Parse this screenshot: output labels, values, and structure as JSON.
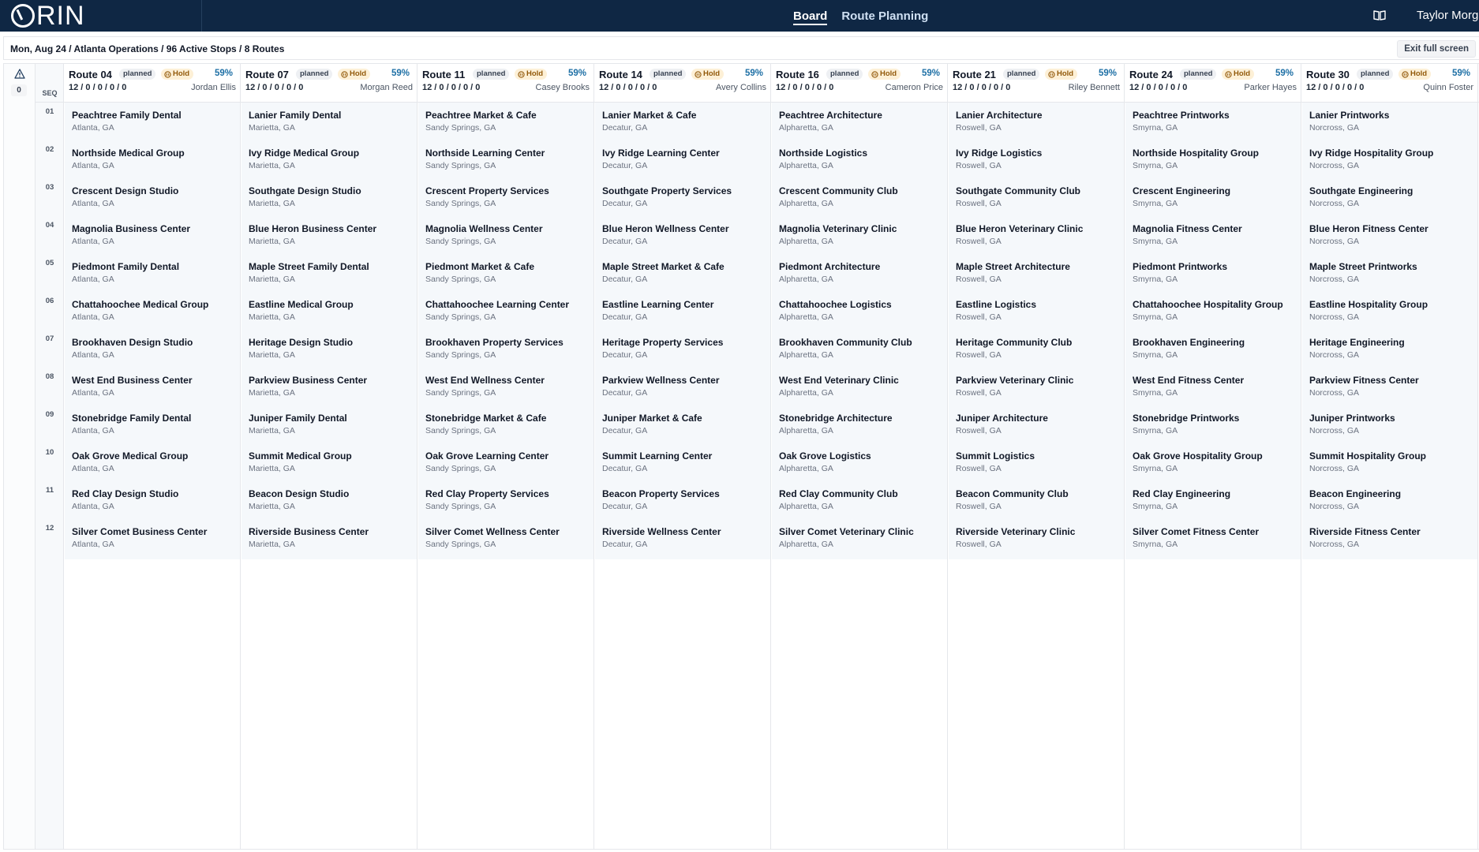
{
  "app": {
    "logo_text": "ORIN",
    "nav": [
      {
        "label": "Board",
        "active": true
      },
      {
        "label": "Route Planning",
        "active": false
      }
    ],
    "user_name": "Taylor Morga",
    "icons": {
      "logo": "orin-logo-icon",
      "docs": "book-icon",
      "warning": "warning-triangle-icon",
      "hold": "hold-icon"
    }
  },
  "breadcrumb": "Mon, Aug 24 / Atlanta Operations / 96 Active Stops / 8 Routes",
  "exit_label": "Exit full screen",
  "warning_count": "0",
  "seq_label": "SEQ",
  "seq_numbers": [
    "01",
    "02",
    "03",
    "04",
    "05",
    "06",
    "07",
    "08",
    "09",
    "10",
    "11",
    "12"
  ],
  "colors": {
    "nav_bg": "#0f2744",
    "hold_bg": "#fdf0d6",
    "pct": "#1d6fa5",
    "stop_bg": "#f5f8fb"
  },
  "routes": [
    {
      "name": "Route 04",
      "status": "planned",
      "hold": "Hold",
      "pct": "59%",
      "counts": "12 / 0 / 0 / 0 / 0",
      "driver": "Jordan Ellis",
      "stops": [
        {
          "name": "Peachtree Family Dental",
          "city": "Atlanta, GA"
        },
        {
          "name": "Northside Medical Group",
          "city": "Atlanta, GA"
        },
        {
          "name": "Crescent Design Studio",
          "city": "Atlanta, GA"
        },
        {
          "name": "Magnolia Business Center",
          "city": "Atlanta, GA"
        },
        {
          "name": "Piedmont Family Dental",
          "city": "Atlanta, GA"
        },
        {
          "name": "Chattahoochee Medical Group",
          "city": "Atlanta, GA"
        },
        {
          "name": "Brookhaven Design Studio",
          "city": "Atlanta, GA"
        },
        {
          "name": "West End Business Center",
          "city": "Atlanta, GA"
        },
        {
          "name": "Stonebridge Family Dental",
          "city": "Atlanta, GA"
        },
        {
          "name": "Oak Grove Medical Group",
          "city": "Atlanta, GA"
        },
        {
          "name": "Red Clay Design Studio",
          "city": "Atlanta, GA"
        },
        {
          "name": "Silver Comet Business Center",
          "city": "Atlanta, GA"
        }
      ]
    },
    {
      "name": "Route 07",
      "status": "planned",
      "hold": "Hold",
      "pct": "59%",
      "counts": "12 / 0 / 0 / 0 / 0",
      "driver": "Morgan Reed",
      "stops": [
        {
          "name": "Lanier Family Dental",
          "city": "Marietta, GA"
        },
        {
          "name": "Ivy Ridge Medical Group",
          "city": "Marietta, GA"
        },
        {
          "name": "Southgate Design Studio",
          "city": "Marietta, GA"
        },
        {
          "name": "Blue Heron Business Center",
          "city": "Marietta, GA"
        },
        {
          "name": "Maple Street Family Dental",
          "city": "Marietta, GA"
        },
        {
          "name": "Eastline Medical Group",
          "city": "Marietta, GA"
        },
        {
          "name": "Heritage Design Studio",
          "city": "Marietta, GA"
        },
        {
          "name": "Parkview Business Center",
          "city": "Marietta, GA"
        },
        {
          "name": "Juniper Family Dental",
          "city": "Marietta, GA"
        },
        {
          "name": "Summit Medical Group",
          "city": "Marietta, GA"
        },
        {
          "name": "Beacon Design Studio",
          "city": "Marietta, GA"
        },
        {
          "name": "Riverside Business Center",
          "city": "Marietta, GA"
        }
      ]
    },
    {
      "name": "Route 11",
      "status": "planned",
      "hold": "Hold",
      "pct": "59%",
      "counts": "12 / 0 / 0 / 0 / 0",
      "driver": "Casey Brooks",
      "stops": [
        {
          "name": "Peachtree Market & Cafe",
          "city": "Sandy Springs, GA"
        },
        {
          "name": "Northside Learning Center",
          "city": "Sandy Springs, GA"
        },
        {
          "name": "Crescent Property Services",
          "city": "Sandy Springs, GA"
        },
        {
          "name": "Magnolia Wellness Center",
          "city": "Sandy Springs, GA"
        },
        {
          "name": "Piedmont Market & Cafe",
          "city": "Sandy Springs, GA"
        },
        {
          "name": "Chattahoochee Learning Center",
          "city": "Sandy Springs, GA"
        },
        {
          "name": "Brookhaven Property Services",
          "city": "Sandy Springs, GA"
        },
        {
          "name": "West End Wellness Center",
          "city": "Sandy Springs, GA"
        },
        {
          "name": "Stonebridge Market & Cafe",
          "city": "Sandy Springs, GA"
        },
        {
          "name": "Oak Grove Learning Center",
          "city": "Sandy Springs, GA"
        },
        {
          "name": "Red Clay Property Services",
          "city": "Sandy Springs, GA"
        },
        {
          "name": "Silver Comet Wellness Center",
          "city": "Sandy Springs, GA"
        }
      ]
    },
    {
      "name": "Route 14",
      "status": "planned",
      "hold": "Hold",
      "pct": "59%",
      "counts": "12 / 0 / 0 / 0 / 0",
      "driver": "Avery Collins",
      "stops": [
        {
          "name": "Lanier Market & Cafe",
          "city": "Decatur, GA"
        },
        {
          "name": "Ivy Ridge Learning Center",
          "city": "Decatur, GA"
        },
        {
          "name": "Southgate Property Services",
          "city": "Decatur, GA"
        },
        {
          "name": "Blue Heron Wellness Center",
          "city": "Decatur, GA"
        },
        {
          "name": "Maple Street Market & Cafe",
          "city": "Decatur, GA"
        },
        {
          "name": "Eastline Learning Center",
          "city": "Decatur, GA"
        },
        {
          "name": "Heritage Property Services",
          "city": "Decatur, GA"
        },
        {
          "name": "Parkview Wellness Center",
          "city": "Decatur, GA"
        },
        {
          "name": "Juniper Market & Cafe",
          "city": "Decatur, GA"
        },
        {
          "name": "Summit Learning Center",
          "city": "Decatur, GA"
        },
        {
          "name": "Beacon Property Services",
          "city": "Decatur, GA"
        },
        {
          "name": "Riverside Wellness Center",
          "city": "Decatur, GA"
        }
      ]
    },
    {
      "name": "Route 16",
      "status": "planned",
      "hold": "Hold",
      "pct": "59%",
      "counts": "12 / 0 / 0 / 0 / 0",
      "driver": "Cameron Price",
      "stops": [
        {
          "name": "Peachtree Architecture",
          "city": "Alpharetta, GA"
        },
        {
          "name": "Northside Logistics",
          "city": "Alpharetta, GA"
        },
        {
          "name": "Crescent Community Club",
          "city": "Alpharetta, GA"
        },
        {
          "name": "Magnolia Veterinary Clinic",
          "city": "Alpharetta, GA"
        },
        {
          "name": "Piedmont Architecture",
          "city": "Alpharetta, GA"
        },
        {
          "name": "Chattahoochee Logistics",
          "city": "Alpharetta, GA"
        },
        {
          "name": "Brookhaven Community Club",
          "city": "Alpharetta, GA"
        },
        {
          "name": "West End Veterinary Clinic",
          "city": "Alpharetta, GA"
        },
        {
          "name": "Stonebridge Architecture",
          "city": "Alpharetta, GA"
        },
        {
          "name": "Oak Grove Logistics",
          "city": "Alpharetta, GA"
        },
        {
          "name": "Red Clay Community Club",
          "city": "Alpharetta, GA"
        },
        {
          "name": "Silver Comet Veterinary Clinic",
          "city": "Alpharetta, GA"
        }
      ]
    },
    {
      "name": "Route 21",
      "status": "planned",
      "hold": "Hold",
      "pct": "59%",
      "counts": "12 / 0 / 0 / 0 / 0",
      "driver": "Riley Bennett",
      "stops": [
        {
          "name": "Lanier Architecture",
          "city": "Roswell, GA"
        },
        {
          "name": "Ivy Ridge Logistics",
          "city": "Roswell, GA"
        },
        {
          "name": "Southgate Community Club",
          "city": "Roswell, GA"
        },
        {
          "name": "Blue Heron Veterinary Clinic",
          "city": "Roswell, GA"
        },
        {
          "name": "Maple Street Architecture",
          "city": "Roswell, GA"
        },
        {
          "name": "Eastline Logistics",
          "city": "Roswell, GA"
        },
        {
          "name": "Heritage Community Club",
          "city": "Roswell, GA"
        },
        {
          "name": "Parkview Veterinary Clinic",
          "city": "Roswell, GA"
        },
        {
          "name": "Juniper Architecture",
          "city": "Roswell, GA"
        },
        {
          "name": "Summit Logistics",
          "city": "Roswell, GA"
        },
        {
          "name": "Beacon Community Club",
          "city": "Roswell, GA"
        },
        {
          "name": "Riverside Veterinary Clinic",
          "city": "Roswell, GA"
        }
      ]
    },
    {
      "name": "Route 24",
      "status": "planned",
      "hold": "Hold",
      "pct": "59%",
      "counts": "12 / 0 / 0 / 0 / 0",
      "driver": "Parker Hayes",
      "stops": [
        {
          "name": "Peachtree Printworks",
          "city": "Smyrna, GA"
        },
        {
          "name": "Northside Hospitality Group",
          "city": "Smyrna, GA"
        },
        {
          "name": "Crescent Engineering",
          "city": "Smyrna, GA"
        },
        {
          "name": "Magnolia Fitness Center",
          "city": "Smyrna, GA"
        },
        {
          "name": "Piedmont Printworks",
          "city": "Smyrna, GA"
        },
        {
          "name": "Chattahoochee Hospitality Group",
          "city": "Smyrna, GA"
        },
        {
          "name": "Brookhaven Engineering",
          "city": "Smyrna, GA"
        },
        {
          "name": "West End Fitness Center",
          "city": "Smyrna, GA"
        },
        {
          "name": "Stonebridge Printworks",
          "city": "Smyrna, GA"
        },
        {
          "name": "Oak Grove Hospitality Group",
          "city": "Smyrna, GA"
        },
        {
          "name": "Red Clay Engineering",
          "city": "Smyrna, GA"
        },
        {
          "name": "Silver Comet Fitness Center",
          "city": "Smyrna, GA"
        }
      ]
    },
    {
      "name": "Route 30",
      "status": "planned",
      "hold": "Hold",
      "pct": "59%",
      "counts": "12 / 0 / 0 / 0 / 0",
      "driver": "Quinn Foster",
      "stops": [
        {
          "name": "Lanier Printworks",
          "city": "Norcross, GA"
        },
        {
          "name": "Ivy Ridge Hospitality Group",
          "city": "Norcross, GA"
        },
        {
          "name": "Southgate Engineering",
          "city": "Norcross, GA"
        },
        {
          "name": "Blue Heron Fitness Center",
          "city": "Norcross, GA"
        },
        {
          "name": "Maple Street Printworks",
          "city": "Norcross, GA"
        },
        {
          "name": "Eastline Hospitality Group",
          "city": "Norcross, GA"
        },
        {
          "name": "Heritage Engineering",
          "city": "Norcross, GA"
        },
        {
          "name": "Parkview Fitness Center",
          "city": "Norcross, GA"
        },
        {
          "name": "Juniper Printworks",
          "city": "Norcross, GA"
        },
        {
          "name": "Summit Hospitality Group",
          "city": "Norcross, GA"
        },
        {
          "name": "Beacon Engineering",
          "city": "Norcross, GA"
        },
        {
          "name": "Riverside Fitness Center",
          "city": "Norcross, GA"
        }
      ]
    }
  ]
}
